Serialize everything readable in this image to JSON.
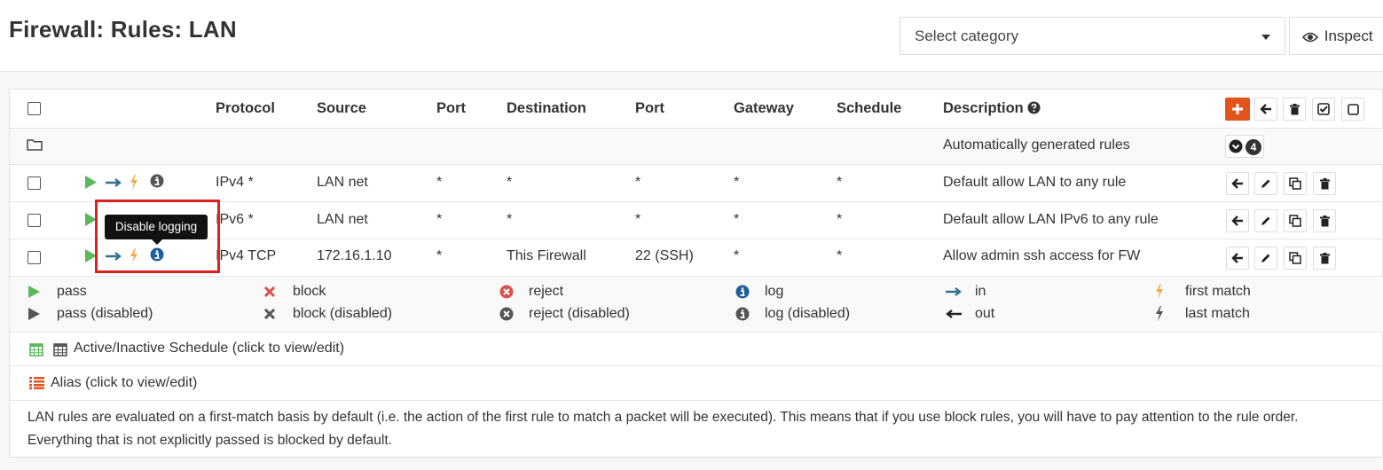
{
  "page": {
    "title": "Firewall: Rules: LAN"
  },
  "toolbar": {
    "category_select": "Select category",
    "inspect_label": "Inspect"
  },
  "table": {
    "headers": {
      "protocol": "Protocol",
      "source": "Source",
      "port": "Port",
      "destination": "Destination",
      "dest_port": "Port",
      "gateway": "Gateway",
      "schedule": "Schedule",
      "description": "Description"
    },
    "group": {
      "description": "Automatically generated rules",
      "count": "4"
    },
    "rows": [
      {
        "protocol": "IPv4 *",
        "source": "LAN net",
        "port": "*",
        "destination": "*",
        "dest_port": "*",
        "gateway": "*",
        "schedule": "*",
        "description": "Default allow LAN to any rule"
      },
      {
        "protocol": "IPv6 *",
        "source": "LAN net",
        "port": "*",
        "destination": "*",
        "dest_port": "*",
        "gateway": "*",
        "schedule": "*",
        "description": "Default allow LAN IPv6 to any rule"
      },
      {
        "protocol": "IPv4 TCP",
        "source": "172.16.1.10",
        "port": "*",
        "destination": "This Firewall",
        "dest_port": "22 (SSH)",
        "gateway": "*",
        "schedule": "*",
        "description": "Allow admin ssh access for FW"
      }
    ]
  },
  "tooltip": {
    "text": "Disable logging"
  },
  "legend": {
    "pass": "pass",
    "pass_disabled": "pass (disabled)",
    "block": "block",
    "block_disabled": "block (disabled)",
    "reject": "reject",
    "reject_disabled": "reject (disabled)",
    "log": "log",
    "log_disabled": "log (disabled)",
    "in": "in",
    "out": "out",
    "first_match": "first match",
    "last_match": "last match"
  },
  "footer": {
    "schedule_note": "Active/Inactive Schedule (click to view/edit)",
    "alias_note": "Alias (click to view/edit)",
    "info_text": "LAN rules are evaluated on a first-match basis by default (i.e. the action of the first rule to match a packet will be executed). This means that if you use block rules, you will have to pay attention to the rule order. Everything that is not explicitly passed is blocked by default."
  },
  "colors": {
    "accent": "#e2541b",
    "pass": "#5cb85c",
    "block": "#d9534f",
    "in_arrow": "#31708f",
    "lightning": "#f0ad4e",
    "info": "#31708f",
    "tooltip_bg": "#111111",
    "highlight": "#e02020"
  }
}
